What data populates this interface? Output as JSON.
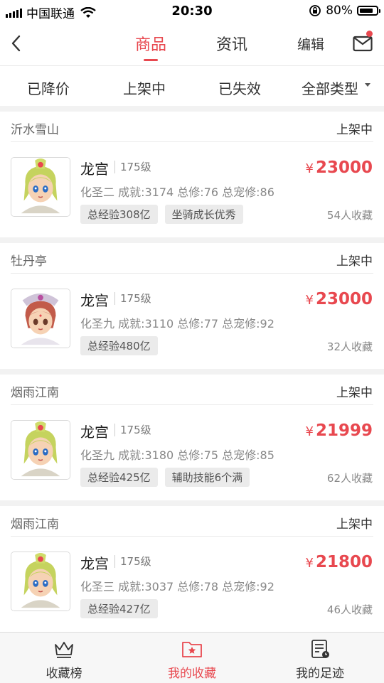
{
  "status_bar": {
    "carrier": "中国联通",
    "time": "20:30",
    "battery": "80%",
    "battery_level": 0.8
  },
  "nav": {
    "tabs": [
      "商品",
      "资讯"
    ],
    "active_tab": 0,
    "edit_label": "编辑",
    "has_unread_mail": true
  },
  "filters": {
    "labels": [
      "已降价",
      "上架中",
      "已失效",
      "全部类型"
    ]
  },
  "items": [
    {
      "server": "沂水雪山",
      "status": "上架中",
      "role": "龙宫",
      "level": "175级",
      "currency": "¥",
      "price": "23000",
      "stats": "化圣二 成就:3174 总修:76 总宠修:86",
      "tags": [
        "总经验308亿",
        "坐骑成长优秀"
      ],
      "favorites": "54人收藏",
      "avatar": "dragon-palace-character-avatar"
    },
    {
      "server": "牡丹亭",
      "status": "上架中",
      "role": "龙宫",
      "level": "175级",
      "currency": "¥",
      "price": "23000",
      "stats": "化圣九 成就:3110 总修:77 总宠修:92",
      "tags": [
        "总经验480亿"
      ],
      "favorites": "32人收藏",
      "avatar": "dragon-palace-character-avatar-alt"
    },
    {
      "server": "烟雨江南",
      "status": "上架中",
      "role": "龙宫",
      "level": "175级",
      "currency": "¥",
      "price": "21999",
      "stats": "化圣九 成就:3180 总修:75 总宠修:85",
      "tags": [
        "总经验425亿",
        "辅助技能6个满"
      ],
      "favorites": "62人收藏",
      "avatar": "dragon-palace-character-avatar"
    },
    {
      "server": "烟雨江南",
      "status": "上架中",
      "role": "龙宫",
      "level": "175级",
      "currency": "¥",
      "price": "21800",
      "stats": "化圣三 成就:3037 总修:78 总宠修:92",
      "tags": [
        "总经验427亿"
      ],
      "favorites": "46人收藏",
      "avatar": "dragon-palace-character-avatar"
    }
  ],
  "tabbar": {
    "items": [
      {
        "label": "收藏榜",
        "icon": "crown-icon"
      },
      {
        "label": "我的收藏",
        "icon": "star-folder-icon"
      },
      {
        "label": "我的足迹",
        "icon": "history-list-icon"
      }
    ],
    "active": 1
  },
  "colors": {
    "accent": "#e8484f",
    "avatar_hair": "#c5d35e",
    "avatar_hair_alt": "#c25b4a"
  }
}
